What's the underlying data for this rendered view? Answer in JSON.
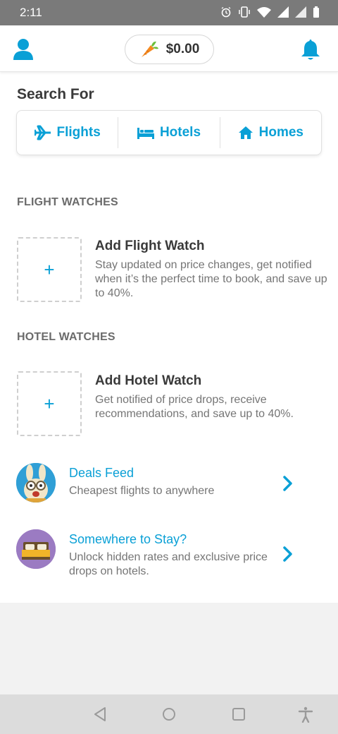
{
  "status_bar": {
    "time": "2:11",
    "icons": [
      "alarm-icon",
      "vibrate-icon",
      "wifi-icon",
      "signal-icon",
      "signal-icon",
      "battery-icon"
    ]
  },
  "header": {
    "profile_icon": "user-icon",
    "wallet_icon": "carrot-icon",
    "wallet_amount": "$0.00",
    "bell_icon": "bell-icon"
  },
  "search": {
    "title": "Search For",
    "tabs": [
      {
        "label": "Flights",
        "icon": "airplane-icon"
      },
      {
        "label": "Hotels",
        "icon": "bed-icon"
      },
      {
        "label": "Homes",
        "icon": "house-icon"
      }
    ]
  },
  "flight_watches": {
    "heading": "FLIGHT WATCHES",
    "add_symbol": "+",
    "title": "Add Flight Watch",
    "description": "Stay updated on price changes, get notified when it’s the perfect time to book, and save up to 40%."
  },
  "hotel_watches": {
    "heading": "HOTEL WATCHES",
    "add_symbol": "+",
    "title": "Add Hotel Watch",
    "description": "Get notified of price drops, receive recommendations, and save up to 40%."
  },
  "promos": [
    {
      "title": "Deals Feed",
      "description": "Cheapest flights to anywhere",
      "icon": "bunny-mascot-icon"
    },
    {
      "title": "Somewhere to Stay?",
      "description": "Unlock hidden rates and exclusive price drops on hotels.",
      "icon": "bed-icon"
    }
  ],
  "nav_bar": {
    "buttons": [
      "back-icon",
      "home-icon",
      "recents-icon",
      "accessibility-icon"
    ]
  },
  "colors": {
    "accent": "#0aa0d6",
    "status_bar": "#7a7a7a",
    "promo_avatar_1": "#2f9fd6",
    "promo_avatar_2": "#9b7bc2"
  }
}
